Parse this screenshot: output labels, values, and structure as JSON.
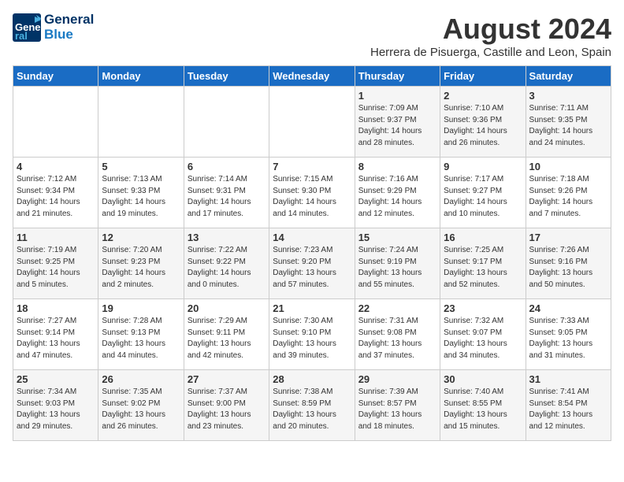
{
  "logo": {
    "line1": "General",
    "line2": "Blue"
  },
  "title": "August 2024",
  "location": "Herrera de Pisuerga, Castille and Leon, Spain",
  "weekdays": [
    "Sunday",
    "Monday",
    "Tuesday",
    "Wednesday",
    "Thursday",
    "Friday",
    "Saturday"
  ],
  "weeks": [
    [
      {
        "day": "",
        "content": ""
      },
      {
        "day": "",
        "content": ""
      },
      {
        "day": "",
        "content": ""
      },
      {
        "day": "",
        "content": ""
      },
      {
        "day": "1",
        "content": "Sunrise: 7:09 AM\nSunset: 9:37 PM\nDaylight: 14 hours\nand 28 minutes."
      },
      {
        "day": "2",
        "content": "Sunrise: 7:10 AM\nSunset: 9:36 PM\nDaylight: 14 hours\nand 26 minutes."
      },
      {
        "day": "3",
        "content": "Sunrise: 7:11 AM\nSunset: 9:35 PM\nDaylight: 14 hours\nand 24 minutes."
      }
    ],
    [
      {
        "day": "4",
        "content": "Sunrise: 7:12 AM\nSunset: 9:34 PM\nDaylight: 14 hours\nand 21 minutes."
      },
      {
        "day": "5",
        "content": "Sunrise: 7:13 AM\nSunset: 9:33 PM\nDaylight: 14 hours\nand 19 minutes."
      },
      {
        "day": "6",
        "content": "Sunrise: 7:14 AM\nSunset: 9:31 PM\nDaylight: 14 hours\nand 17 minutes."
      },
      {
        "day": "7",
        "content": "Sunrise: 7:15 AM\nSunset: 9:30 PM\nDaylight: 14 hours\nand 14 minutes."
      },
      {
        "day": "8",
        "content": "Sunrise: 7:16 AM\nSunset: 9:29 PM\nDaylight: 14 hours\nand 12 minutes."
      },
      {
        "day": "9",
        "content": "Sunrise: 7:17 AM\nSunset: 9:27 PM\nDaylight: 14 hours\nand 10 minutes."
      },
      {
        "day": "10",
        "content": "Sunrise: 7:18 AM\nSunset: 9:26 PM\nDaylight: 14 hours\nand 7 minutes."
      }
    ],
    [
      {
        "day": "11",
        "content": "Sunrise: 7:19 AM\nSunset: 9:25 PM\nDaylight: 14 hours\nand 5 minutes."
      },
      {
        "day": "12",
        "content": "Sunrise: 7:20 AM\nSunset: 9:23 PM\nDaylight: 14 hours\nand 2 minutes."
      },
      {
        "day": "13",
        "content": "Sunrise: 7:22 AM\nSunset: 9:22 PM\nDaylight: 14 hours\nand 0 minutes."
      },
      {
        "day": "14",
        "content": "Sunrise: 7:23 AM\nSunset: 9:20 PM\nDaylight: 13 hours\nand 57 minutes."
      },
      {
        "day": "15",
        "content": "Sunrise: 7:24 AM\nSunset: 9:19 PM\nDaylight: 13 hours\nand 55 minutes."
      },
      {
        "day": "16",
        "content": "Sunrise: 7:25 AM\nSunset: 9:17 PM\nDaylight: 13 hours\nand 52 minutes."
      },
      {
        "day": "17",
        "content": "Sunrise: 7:26 AM\nSunset: 9:16 PM\nDaylight: 13 hours\nand 50 minutes."
      }
    ],
    [
      {
        "day": "18",
        "content": "Sunrise: 7:27 AM\nSunset: 9:14 PM\nDaylight: 13 hours\nand 47 minutes."
      },
      {
        "day": "19",
        "content": "Sunrise: 7:28 AM\nSunset: 9:13 PM\nDaylight: 13 hours\nand 44 minutes."
      },
      {
        "day": "20",
        "content": "Sunrise: 7:29 AM\nSunset: 9:11 PM\nDaylight: 13 hours\nand 42 minutes."
      },
      {
        "day": "21",
        "content": "Sunrise: 7:30 AM\nSunset: 9:10 PM\nDaylight: 13 hours\nand 39 minutes."
      },
      {
        "day": "22",
        "content": "Sunrise: 7:31 AM\nSunset: 9:08 PM\nDaylight: 13 hours\nand 37 minutes."
      },
      {
        "day": "23",
        "content": "Sunrise: 7:32 AM\nSunset: 9:07 PM\nDaylight: 13 hours\nand 34 minutes."
      },
      {
        "day": "24",
        "content": "Sunrise: 7:33 AM\nSunset: 9:05 PM\nDaylight: 13 hours\nand 31 minutes."
      }
    ],
    [
      {
        "day": "25",
        "content": "Sunrise: 7:34 AM\nSunset: 9:03 PM\nDaylight: 13 hours\nand 29 minutes."
      },
      {
        "day": "26",
        "content": "Sunrise: 7:35 AM\nSunset: 9:02 PM\nDaylight: 13 hours\nand 26 minutes."
      },
      {
        "day": "27",
        "content": "Sunrise: 7:37 AM\nSunset: 9:00 PM\nDaylight: 13 hours\nand 23 minutes."
      },
      {
        "day": "28",
        "content": "Sunrise: 7:38 AM\nSunset: 8:59 PM\nDaylight: 13 hours\nand 20 minutes."
      },
      {
        "day": "29",
        "content": "Sunrise: 7:39 AM\nSunset: 8:57 PM\nDaylight: 13 hours\nand 18 minutes."
      },
      {
        "day": "30",
        "content": "Sunrise: 7:40 AM\nSunset: 8:55 PM\nDaylight: 13 hours\nand 15 minutes."
      },
      {
        "day": "31",
        "content": "Sunrise: 7:41 AM\nSunset: 8:54 PM\nDaylight: 13 hours\nand 12 minutes."
      }
    ]
  ]
}
